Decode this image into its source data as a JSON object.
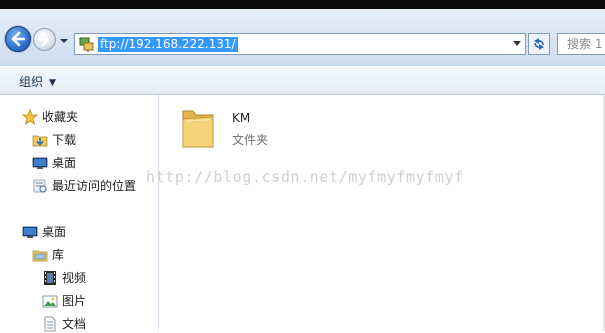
{
  "address_bar": {
    "path": "ftp://192.168.222.131/",
    "search_placeholder": "搜索 1"
  },
  "toolbar": {
    "organize_label": "组织",
    "organize_caret": "▼"
  },
  "navigation": {
    "favorites": {
      "label": "收藏夹",
      "items": [
        {
          "label": "下载",
          "icon": "download-folder-icon"
        },
        {
          "label": "桌面",
          "icon": "desktop-icon"
        },
        {
          "label": "最近访问的位置",
          "icon": "recent-places-icon"
        }
      ]
    },
    "desktop_root": {
      "label": "桌面",
      "icon": "desktop-icon"
    },
    "libraries": {
      "label": "库",
      "items": [
        {
          "label": "视频",
          "icon": "video-library-icon"
        },
        {
          "label": "图片",
          "icon": "pictures-library-icon"
        },
        {
          "label": "文档",
          "icon": "documents-library-icon"
        }
      ]
    }
  },
  "content": {
    "items": [
      {
        "name": "KM",
        "type": "文件夹",
        "icon": "folder-icon"
      }
    ]
  },
  "watermark": "http://blog.csdn.net/myfmyfmyfmyf",
  "colors": {
    "selection": "#3399ff",
    "address_border": "#7f9db9",
    "folder_yellow": "#f0c85a"
  }
}
